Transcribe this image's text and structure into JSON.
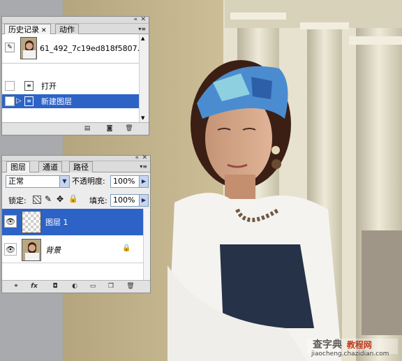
{
  "history_panel": {
    "tabs": [
      "历史记录",
      "动作"
    ],
    "snapshot_name": "61_492_7c19ed818f5807...",
    "items": [
      {
        "label": "打开"
      },
      {
        "label": "新建图层"
      }
    ]
  },
  "layers_panel": {
    "tabs": [
      "图层",
      "通道",
      "路径"
    ],
    "blend_mode": "正常",
    "opacity_label": "不透明度:",
    "opacity_value": "100%",
    "lock_label": "锁定:",
    "fill_label": "填充:",
    "fill_value": "100%",
    "layers": [
      {
        "name": "图层 1",
        "selected": true
      },
      {
        "name": "背景",
        "selected": false,
        "locked": true
      }
    ]
  },
  "watermark": {
    "brand_a": "查字典",
    "brand_b": "教程网",
    "url": "jiaocheng.chazidian.com"
  },
  "colors": {
    "selection": "#2d63c6",
    "panel_bg": "#ececec",
    "tab_bg": "#dcdcdc"
  }
}
